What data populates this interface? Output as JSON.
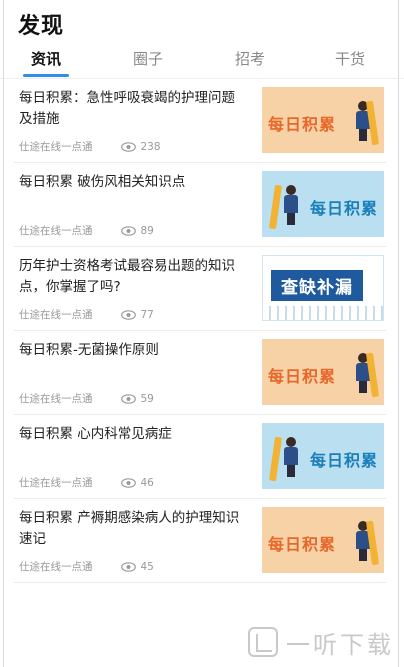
{
  "header": {
    "title": "发现"
  },
  "tabs": [
    {
      "label": "资讯",
      "active": true
    },
    {
      "label": "圈子",
      "active": false
    },
    {
      "label": "招考",
      "active": false
    },
    {
      "label": "干货",
      "active": false
    }
  ],
  "articles": [
    {
      "title": "每日积累：急性呼吸衰竭的护理问题及措施",
      "source": "仕途在线一点通",
      "views": "238",
      "thumb_text": "每日积累",
      "thumb_style": "orange"
    },
    {
      "title": "每日积累 破伤风相关知识点",
      "source": "仕途在线一点通",
      "views": "89",
      "thumb_text": "每日积累",
      "thumb_style": "blue"
    },
    {
      "title": "历年护士资格考试最容易出题的知识点，你掌握了吗?",
      "source": "仕途在线一点通",
      "views": "77",
      "thumb_text": "查缺补漏",
      "thumb_style": "navy"
    },
    {
      "title": "每日积累-无菌操作原则",
      "source": "仕途在线一点通",
      "views": "59",
      "thumb_text": "每日积累",
      "thumb_style": "orange"
    },
    {
      "title": "每日积累 心内科常见病症",
      "source": "仕途在线一点通",
      "views": "46",
      "thumb_text": "每日积累",
      "thumb_style": "blue"
    },
    {
      "title": "每日积累 产褥期感染病人的护理知识速记",
      "source": "仕途在线一点通",
      "views": "45",
      "thumb_text": "每日积累",
      "thumb_style": "orange"
    }
  ],
  "watermark": {
    "text": "一听下载"
  },
  "colors": {
    "accent": "#2f8fe6",
    "orange_thumb": "#f7d2a6",
    "blue_thumb": "#b9dff1",
    "navy": "#1f5a9e"
  },
  "icons": {
    "views": "eye-icon"
  }
}
